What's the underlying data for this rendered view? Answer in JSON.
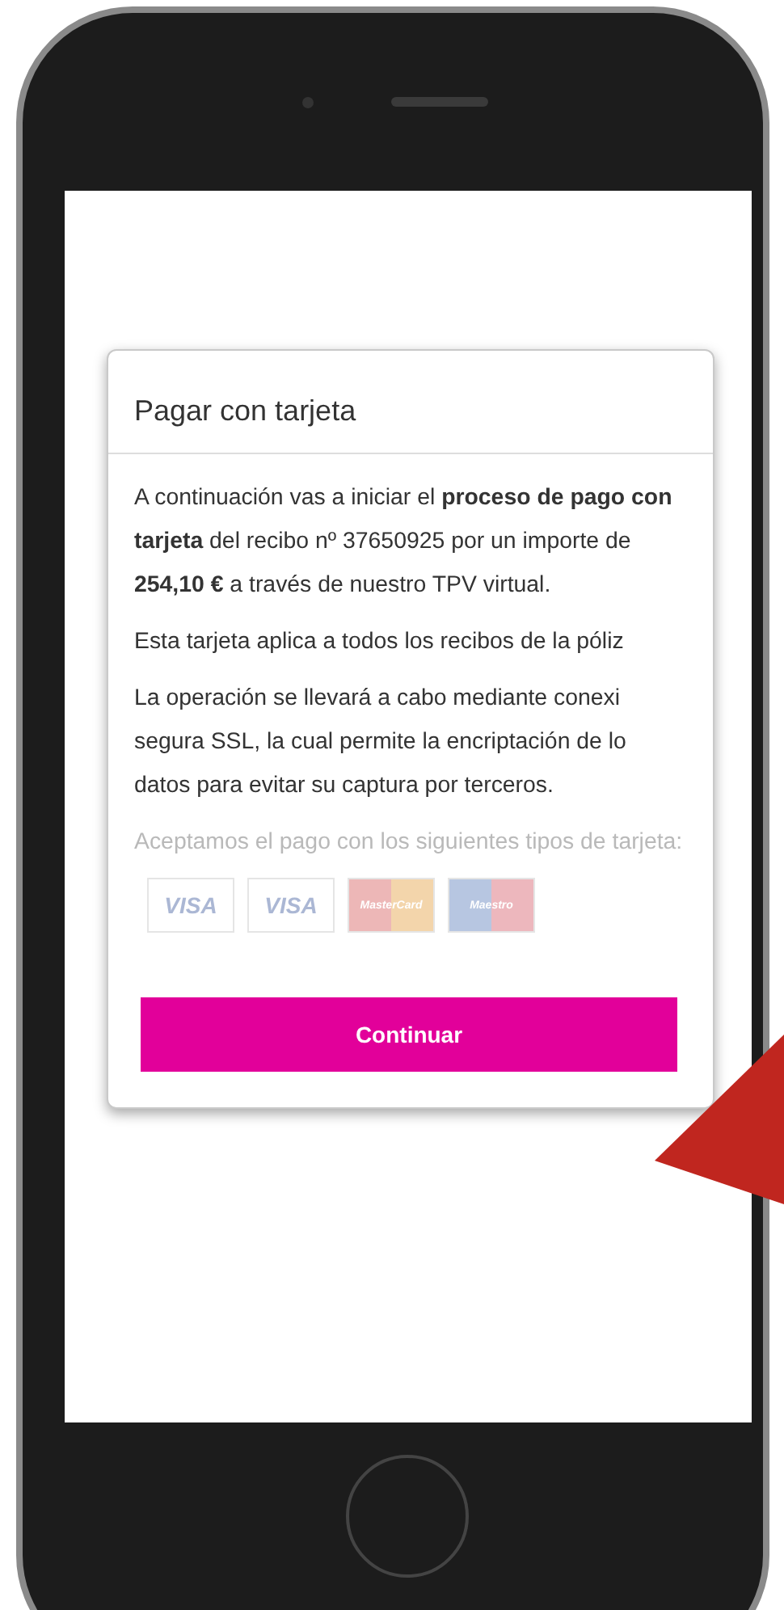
{
  "dialog": {
    "title": "Pagar con tarjeta",
    "intro": "A continuación vas a iniciar el **proceso de pago con tarjeta** del recibo nº 37650925 por un importe de **254,10 €** a través de nuestro TPV virtual.",
    "policy_note": "Esta tarjeta aplica a todos los recibos de la póliz",
    "security_lines": [
      "La operación se llevará a cabo mediante conexi",
      "segura SSL, la cual permite la encriptación de lo",
      "datos para evitar su captura por terceros."
    ],
    "cards_label": "Aceptamos el pago con los siguientes tipos de tarjeta:",
    "card_logos": [
      {
        "kind": "visa",
        "label": "VISA"
      },
      {
        "kind": "visa",
        "label": "VISA"
      },
      {
        "kind": "circles",
        "label": "MasterCard"
      },
      {
        "kind": "circles",
        "label": "Maestro"
      }
    ],
    "button": "Continuar"
  }
}
